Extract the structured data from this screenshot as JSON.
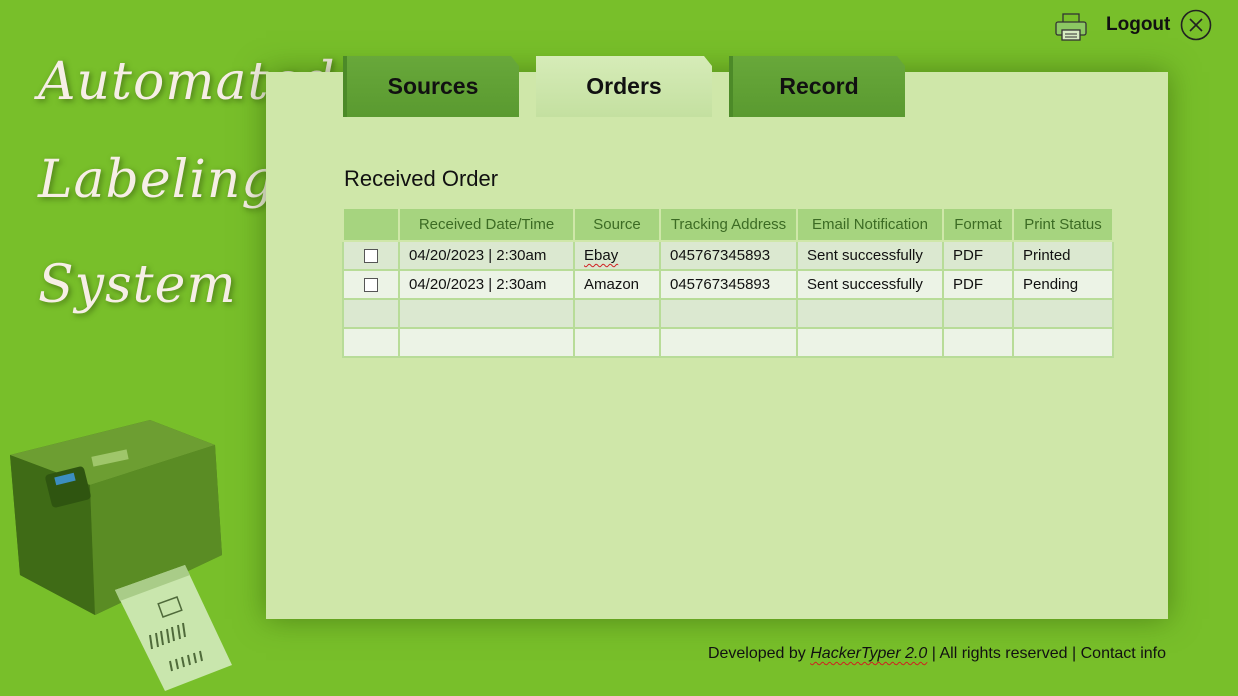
{
  "app": {
    "title_lines": [
      "Automated",
      "Labeling",
      "System"
    ]
  },
  "topbar": {
    "logout_label": "Logout"
  },
  "tabs": [
    {
      "label": "Sources",
      "active": false
    },
    {
      "label": "Orders",
      "active": true
    },
    {
      "label": "Record",
      "active": false
    }
  ],
  "orders": {
    "title": "Received Order",
    "columns": [
      "",
      "Received Date/Time",
      "Source",
      "Tracking Address",
      "Email Notification",
      "Format",
      "Print Status"
    ],
    "rows": [
      {
        "datetime": "04/20/2023 | 2:30am",
        "source": "Ebay",
        "tracking": "045767345893",
        "email": "Sent successfully",
        "format": "PDF",
        "status": "Printed"
      },
      {
        "datetime": "04/20/2023 | 2:30am",
        "source": "Amazon",
        "tracking": "045767345893",
        "email": "Sent successfully",
        "format": "PDF",
        "status": "Pending"
      },
      {
        "datetime": "",
        "source": "",
        "tracking": "",
        "email": "",
        "format": "",
        "status": ""
      },
      {
        "datetime": "",
        "source": "",
        "tracking": "",
        "email": "",
        "format": "",
        "status": ""
      }
    ]
  },
  "footer": {
    "developed_by": "Developed by",
    "developer": "HackerTyper 2.0",
    "sep1": "|",
    "rights": "All rights reserved",
    "sep2": "|",
    "contact": "Contact info"
  },
  "colors": {
    "background": "#78bf2a",
    "panel": "#cfe7a9",
    "tab_inactive": "#62a236",
    "tab_active": "#cde6ad",
    "header_cell": "#a6d47f"
  },
  "icons": {
    "print": "printer-icon",
    "close": "close-circle-icon",
    "printer_image": "thermal-label-printer"
  }
}
